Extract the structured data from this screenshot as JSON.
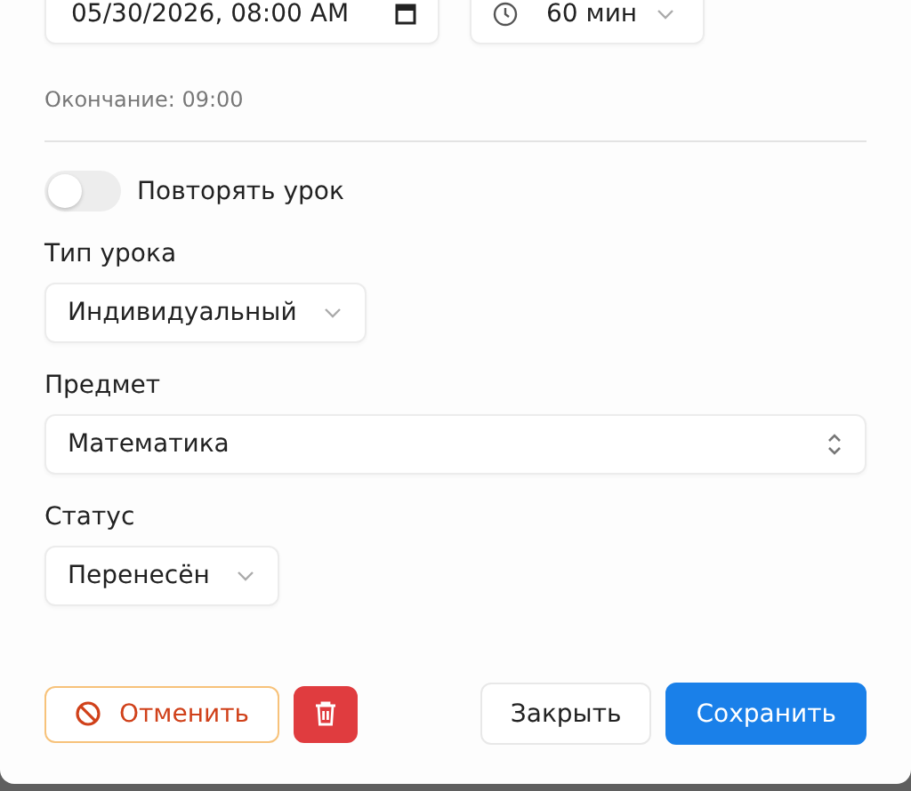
{
  "start": {
    "value": "05/30/2026, 08:00 AM"
  },
  "duration": {
    "value": "60 мин"
  },
  "end_note": "Окончание: 09:00",
  "repeat": {
    "label": "Повторять урок",
    "on": false
  },
  "fields": [
    {
      "label": "Тип урока",
      "value": "Индивидуальный",
      "kind": "dropdown"
    },
    {
      "label": "Предмет",
      "value": "Математика",
      "kind": "combobox"
    },
    {
      "label": "Статус",
      "value": "Перенесён",
      "kind": "dropdown"
    }
  ],
  "buttons": {
    "cancel": "Отменить",
    "close": "Закрыть",
    "save": "Сохранить"
  }
}
